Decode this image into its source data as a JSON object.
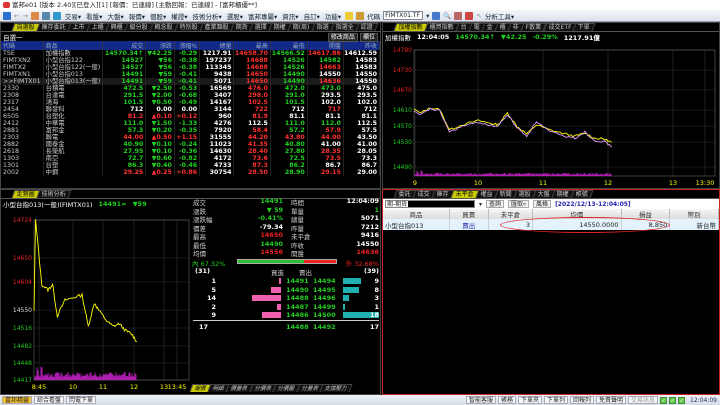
{
  "title": "富邦e01 [版本 2.40][已登入][1] [報價：已連線] [主動回報：已連線] - [富邦櫃優**]",
  "toolbar": {
    "menus": [
      "交易▾",
      "看盤▾",
      "大盤▾",
      "報價▾",
      "個股▾",
      "權證▾",
      "技術分析▾",
      "選股▾",
      "富邦專屬▾",
      "資訊▾",
      "自訂▾",
      "功能▾"
    ],
    "code_label": "代碼",
    "code_value": "FIMTX01.TF",
    "analysis": "分析工具▾"
  },
  "quotes": {
    "tabs": [
      "自選股",
      "庫存委託",
      "上市",
      "上櫃",
      "興櫃",
      "級分股",
      "概念股",
      "特別股",
      "產業類股",
      "期貨",
      "選擇",
      "期權",
      "期(周)",
      "指選",
      "指選全",
      "認證"
    ],
    "group": "自選一",
    "edit_label": "修改商品",
    "cols_label": "欄位",
    "headers": [
      "代碼",
      "商品",
      "成交",
      "漲跌",
      "漲幅%",
      "總量",
      "最高",
      "最低",
      "開盤",
      "昨收"
    ],
    "rows": [
      [
        "TSE",
        "加權指數",
        "14570.34↑",
        "▼42.25",
        "-0.29",
        "1217.91",
        "14658.70",
        "14566.52",
        "14617.86",
        "14612.59"
      ],
      [
        "FIMTXN2",
        "小型台指122",
        "14527",
        "▼56",
        "-0.38",
        "197237",
        "14688",
        "14526",
        "14582",
        "14583"
      ],
      [
        "FIMTX2",
        "小型台指122(一般)",
        "14527",
        "▼56",
        "-0.38",
        "113345",
        "14688",
        "14526",
        "14663",
        "14583"
      ],
      [
        "FIMTXN1",
        "小型台指013",
        "14491",
        "▼59",
        "-0.41",
        "9438",
        "14650",
        "14490",
        "14550",
        "14550"
      ],
      [
        ">>FIMTX01",
        "小型台指013(一般)",
        "14491",
        "▼59",
        "-0.41",
        "5071",
        "14650",
        "14490",
        "14636",
        "14550"
      ],
      [
        "2330",
        "台積電",
        "472.5",
        "▼2.50",
        "-0.53",
        "16569",
        "476.0",
        "472.0",
        "473.0",
        "475.0"
      ],
      [
        "2308",
        "台達電",
        "291.5",
        "▼2.00",
        "-0.68",
        "3407",
        "298.0",
        "291.0",
        "293.5",
        "293.5"
      ],
      [
        "2317",
        "鴻海",
        "101.5",
        "▼0.50",
        "-0.49",
        "14167",
        "102.5",
        "101.5",
        "102.0",
        "102.0"
      ],
      [
        "2454",
        "聯發科",
        "712",
        "0.00",
        "0.00",
        "3144",
        "722",
        "712",
        "717",
        "712"
      ],
      [
        "6505",
        "台塑化",
        "81.2",
        "▲0.10",
        "+0.12",
        "960",
        "81.9",
        "81.1",
        "81.1",
        "81.1"
      ],
      [
        "2412",
        "中華電",
        "111.0",
        "▼1.50",
        "-1.33",
        "4276",
        "112.5",
        "111.0",
        "112.0",
        "112.5"
      ],
      [
        "2881",
        "富邦金",
        "57.3",
        "▼0.20",
        "-0.35",
        "7920",
        "58.4",
        "57.2",
        "57.9",
        "57.5"
      ],
      [
        "2303",
        "聯電",
        "44.00",
        "▲0.50",
        "+1.15",
        "31555",
        "44.20",
        "43.80",
        "44.00",
        "43.50"
      ],
      [
        "2882",
        "國泰金",
        "40.90",
        "▼0.10",
        "-0.24",
        "11023",
        "41.35",
        "40.80",
        "41.00",
        "41.00"
      ],
      [
        "2618",
        "長榮航",
        "27.95",
        "▼0.10",
        "-0.36",
        "14630",
        "28.40",
        "27.80",
        "28.35",
        "28.05"
      ],
      [
        "1303",
        "南亞",
        "72.7",
        "▼0.60",
        "-0.82",
        "4172",
        "73.6",
        "72.5",
        "73.5",
        "73.3"
      ],
      [
        "1301",
        "台塑",
        "86.3",
        "▼0.40",
        "-0.46",
        "4733",
        "87.3",
        "86.2",
        "86.7",
        "86.7"
      ],
      [
        "2002",
        "中鋼",
        "29.25",
        "▲0.25",
        "+0.86",
        "30754",
        "29.50",
        "28.90",
        "29.15",
        "29.00"
      ]
    ]
  },
  "index_panel": {
    "tabs": [
      "加權指數",
      "櫃買指數",
      "台",
      "電",
      "金",
      "櫃",
      "非",
      "F散業",
      "成交ETF",
      "下單"
    ],
    "name": "加權指數",
    "time": "12:04:05",
    "price": "14570.34↑",
    "change": "▼42.25",
    "pct": "-0.29%",
    "volume": "1217.91億"
  },
  "chart_data": [
    {
      "type": "line",
      "title": "加權指數",
      "y_ticks": [
        "14790",
        "14730",
        "14670",
        "14610",
        "14570",
        "14530",
        "14490"
      ],
      "x_ticks": [
        "9",
        "10",
        "11",
        "12",
        "13",
        "13:30"
      ],
      "x_hours": [
        9,
        9.1,
        9.25,
        9.4,
        9.55,
        9.75,
        10,
        10.2,
        10.3,
        10.45,
        10.6,
        10.75,
        10.9,
        11.1,
        11.3,
        11.5,
        11.65,
        11.8,
        11.95,
        12.07
      ],
      "series": [
        {
          "name": "index",
          "values": [
            14650,
            14640,
            14652,
            14648,
            14600,
            14612,
            14622,
            14615,
            14612,
            14640,
            14608,
            14590,
            14612,
            14600,
            14592,
            14585,
            14592,
            14580,
            14578,
            14570
          ]
        },
        {
          "name": "futures",
          "values": [
            14645,
            14635,
            14650,
            14645,
            14595,
            14608,
            14618,
            14610,
            14608,
            14636,
            14605,
            14585,
            14620,
            14596,
            14586,
            14580,
            14595,
            14575,
            14572,
            14560
          ]
        }
      ],
      "ylim": [
        14490,
        14790
      ]
    },
    {
      "type": "line",
      "title": "小型台指013(一般)",
      "y_ticks": [
        "14724",
        "14650",
        "14604",
        "14550",
        "14516",
        "14482",
        "14448",
        "14417"
      ],
      "x_ticks": [
        "8:45",
        "10",
        "11",
        "12",
        "13",
        "13:45"
      ],
      "x_hours": [
        8.75,
        8.8,
        9.0,
        9.2,
        9.35,
        9.5,
        9.75,
        10.0,
        10.3,
        10.5,
        10.7,
        10.85,
        11.1,
        11.3,
        11.5,
        11.7,
        11.9,
        12.07
      ],
      "series": [
        {
          "name": "price",
          "values": [
            14550,
            14724,
            14600,
            14590,
            14600,
            14540,
            14570,
            14575,
            14580,
            14520,
            14565,
            14550,
            14530,
            14520,
            14525,
            14512,
            14505,
            14491
          ]
        }
      ],
      "ylim": [
        14417,
        14724
      ]
    }
  ],
  "chart_title": "小型台指013(一般)(FIMTX01)",
  "chart_price": "14491=",
  "chart_change": "▼59",
  "chart_tabs": [
    "走勢圖",
    "技術分析"
  ],
  "quote": {
    "left": [
      [
        "成交",
        "14491"
      ],
      [
        "漲跌",
        "▼ 59"
      ],
      [
        "漲跌幅",
        "-0.41%"
      ],
      [
        "價差",
        "-79.34"
      ],
      [
        "最高",
        "14650"
      ],
      [
        "最低",
        "14490"
      ],
      [
        "均價",
        "14556"
      ]
    ],
    "right": [
      [
        "時間",
        "12:04:09"
      ],
      [
        "單量",
        "1"
      ],
      [
        "總量",
        "5071"
      ],
      [
        "昨量",
        "7212"
      ],
      [
        "未平倉",
        "9416"
      ],
      [
        "昨收",
        "14550"
      ],
      [
        "開盤",
        "14636"
      ]
    ],
    "inner_label": "內 67.32%",
    "outer_label": "外 32.68%",
    "inner_ratio": 0.6732,
    "bid_total": "(31)",
    "ask_total": "(39)",
    "bid_label": "買進",
    "ask_label": "賣出",
    "book": [
      [
        "1",
        "14491",
        "14494",
        "9"
      ],
      [
        "5",
        "14490",
        "14495",
        "8"
      ],
      [
        "14",
        "14488",
        "14496",
        "3"
      ],
      [
        "2",
        "14487",
        "14499",
        "1"
      ],
      [
        "9",
        "14486",
        "14500",
        "18"
      ]
    ],
    "summary": [
      "17",
      "14488",
      "14492",
      "17"
    ],
    "tabs": [
      "報價",
      "明細",
      "價量表",
      "分價表",
      "分價圖",
      "分量表",
      "支撐壓力"
    ]
  },
  "positions": {
    "tabs": [
      "委託",
      "成交",
      "庫存",
      "未平倉",
      "權益",
      "新聞",
      "選股",
      "大盤",
      "期權",
      "帳號"
    ],
    "account": "期-期貨",
    "query": "查詢",
    "fetch": "匯取▿",
    "style": "風格",
    "timestamp": "[2022/12/13-12:04:05]",
    "headers": [
      "商品",
      "買賣",
      "未平倉",
      "均價",
      "損益",
      "幣別"
    ],
    "rows": [
      [
        "小型台指013",
        "賣出",
        "3",
        "14550.0000",
        "8,850",
        "新台幣"
      ]
    ]
  },
  "taskbar": {
    "left": [
      "富邦精靈",
      "綜合看盤",
      "閃電下單"
    ],
    "right": [
      "智能客服",
      "帳務",
      "下單夾",
      "下單列",
      "回報列",
      "免責聲明",
      "交易訊息"
    ],
    "clock": "12:04:09"
  }
}
